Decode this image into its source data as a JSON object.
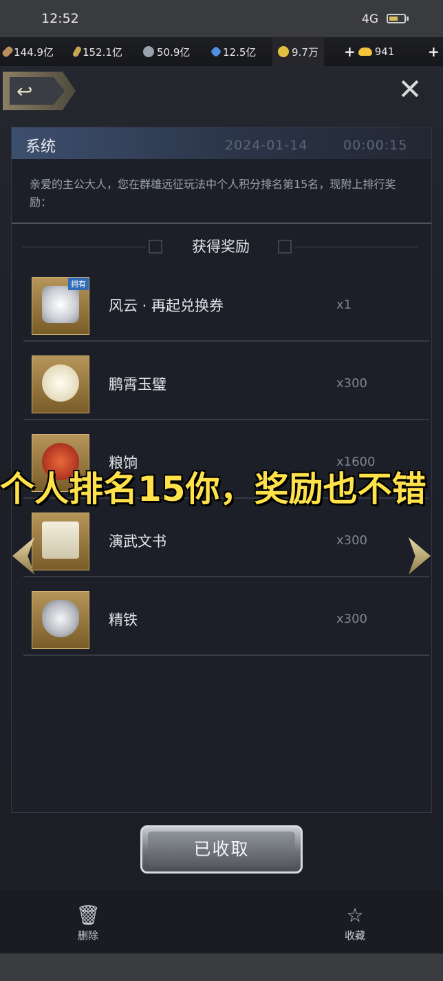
{
  "status_bar": {
    "time": "12:52",
    "network": "4G"
  },
  "resources": [
    {
      "icon": "wood-icon",
      "value": "144.9亿",
      "color": "#b98e60"
    },
    {
      "icon": "grain-icon",
      "value": "152.1亿",
      "color": "#c8a454"
    },
    {
      "icon": "stone-icon",
      "value": "50.9亿",
      "color": "#9aa2ad"
    },
    {
      "icon": "crystal-icon",
      "value": "12.5亿",
      "color": "#4f8fe0"
    },
    {
      "icon": "copper-coin-icon",
      "value": "9.7万",
      "color": "#e4c040"
    },
    {
      "icon": "gold-ingot-icon",
      "value": "941",
      "color": "#f0c53a"
    }
  ],
  "mail": {
    "sender": "系统",
    "date": "2024-01-14",
    "time": "00:00:15",
    "body": "亲爱的主公大人，您在群雄远征玩法中个人积分排名第15名，现附上排行奖励："
  },
  "rewards": {
    "title": "获得奖励",
    "items": [
      {
        "name": "风云 · 再起兑换券",
        "qty": "x1",
        "badge": "拥有",
        "icon": "exchange-ticket-icon",
        "color": "#d9dde2"
      },
      {
        "name": "鹏霄玉璧",
        "qty": "x300",
        "badge": "",
        "icon": "jade-disc-icon",
        "color": "#efe8d2"
      },
      {
        "name": "粮饷",
        "qty": "x1600",
        "badge": "",
        "icon": "grain-ration-icon",
        "color": "#c14a30"
      },
      {
        "name": "演武文书",
        "qty": "x300",
        "badge": "",
        "icon": "book-icon",
        "color": "#e8e2cf"
      },
      {
        "name": "精铁",
        "qty": "x300",
        "badge": "",
        "icon": "iron-ore-icon",
        "color": "#c9ccd2"
      }
    ]
  },
  "caption": "个人排名15你，奖励也不错",
  "claim_button": "已收取",
  "bottom_actions": {
    "delete": "删除",
    "favorite": "收藏"
  }
}
